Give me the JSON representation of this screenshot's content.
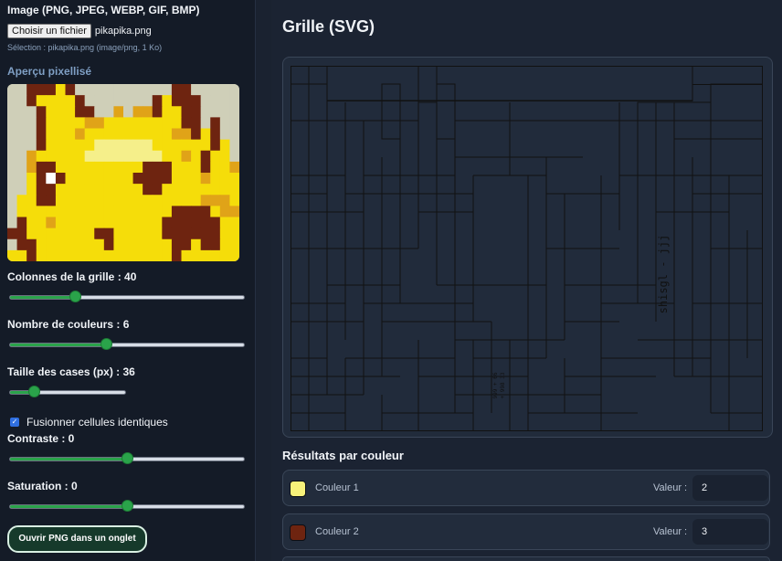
{
  "sidebar": {
    "image_label": "Image (PNG, JPEG, WEBP, GIF, BMP)",
    "file_button": "Choisir un fichier",
    "file_name": "pikapika.png",
    "selection_info": "Sélection : pikapika.png (image/png, 1 Ko)",
    "preview_title": "Aperçu pixellisé",
    "sliders": [
      {
        "label": "Colonnes de la grille : 40",
        "fraction": 0.28
      },
      {
        "label": "Nombre de couleurs : 6",
        "fraction": 0.41
      },
      {
        "label": "Taille des cases (px) : 36",
        "fraction": 0.21
      },
      {
        "label": "Contraste : 0",
        "fraction": 0.5
      },
      {
        "label": "Saturation : 0",
        "fraction": 0.5
      }
    ],
    "merge_checkbox": {
      "label": "Fusionner cellules identiques",
      "checked": true
    },
    "open_button": "Ouvrir PNG dans un onglet"
  },
  "main": {
    "title": "Grille (SVG)",
    "grid_vertical_text": "shisgl - jjj",
    "grid_small_text_1": "999 + 66",
    "grid_small_text_2": "+ 998 33",
    "results_title": "Résultats par couleur",
    "colors": [
      {
        "name": "Couleur 1",
        "value_label": "Valeur :",
        "value": "2",
        "swatch": "#f7f27a"
      },
      {
        "name": "Couleur 2",
        "value_label": "Valeur :",
        "value": "3",
        "swatch": "#6e2410"
      }
    ]
  },
  "palette": {
    "accent": "#2aa34a",
    "pika_yellow": "#f5dd0a",
    "pika_brown": "#6e2410",
    "pika_orange": "#e0a318",
    "pika_light": "#f5ef8a",
    "bg_gray": "#cfcfb8",
    "white": "#ffffff"
  }
}
